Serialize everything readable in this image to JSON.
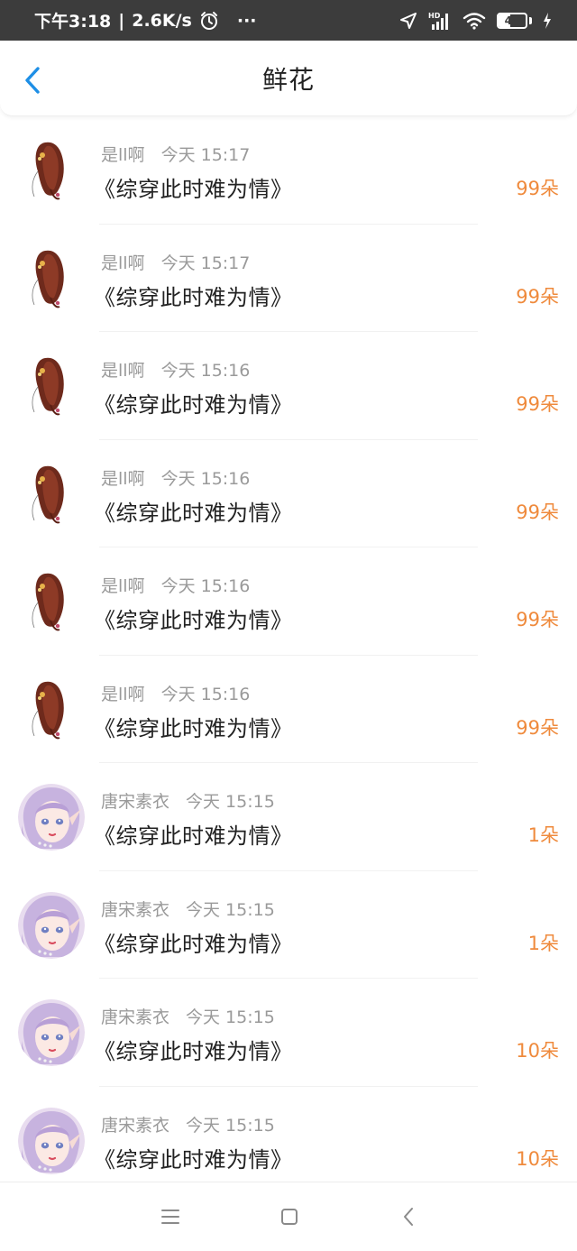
{
  "status_bar": {
    "time": "下午3:18",
    "separator": "|",
    "speed": "2.6K/s",
    "more": "···",
    "battery": "44",
    "battery_level": 0.44,
    "icons": [
      "alarm-icon",
      "location-arrow-icon",
      "hd-signal-icon",
      "wifi-icon",
      "battery-icon",
      "charging-icon"
    ]
  },
  "header": {
    "title": "鲜花",
    "back_icon": "chevron-left-icon",
    "accent_color": "#1e8fe6"
  },
  "gifts": [
    {
      "user": "是ll啊",
      "time": "今天 15:17",
      "book": "《综穿此时难为情》",
      "amount": "99朵",
      "avatar": "hair-avatar"
    },
    {
      "user": "是ll啊",
      "time": "今天 15:17",
      "book": "《综穿此时难为情》",
      "amount": "99朵",
      "avatar": "hair-avatar"
    },
    {
      "user": "是ll啊",
      "time": "今天 15:16",
      "book": "《综穿此时难为情》",
      "amount": "99朵",
      "avatar": "hair-avatar"
    },
    {
      "user": "是ll啊",
      "time": "今天 15:16",
      "book": "《综穿此时难为情》",
      "amount": "99朵",
      "avatar": "hair-avatar"
    },
    {
      "user": "是ll啊",
      "time": "今天 15:16",
      "book": "《综穿此时难为情》",
      "amount": "99朵",
      "avatar": "hair-avatar"
    },
    {
      "user": "是ll啊",
      "time": "今天 15:16",
      "book": "《综穿此时难为情》",
      "amount": "99朵",
      "avatar": "hair-avatar"
    },
    {
      "user": "唐宋素衣",
      "time": "今天 15:15",
      "book": "《综穿此时难为情》",
      "amount": "1朵",
      "avatar": "elf-girl-avatar"
    },
    {
      "user": "唐宋素衣",
      "time": "今天 15:15",
      "book": "《综穿此时难为情》",
      "amount": "1朵",
      "avatar": "elf-girl-avatar"
    },
    {
      "user": "唐宋素衣",
      "time": "今天 15:15",
      "book": "《综穿此时难为情》",
      "amount": "10朵",
      "avatar": "elf-girl-avatar"
    },
    {
      "user": "唐宋素衣",
      "time": "今天 15:15",
      "book": "《综穿此时难为情》",
      "amount": "10朵",
      "avatar": "elf-girl-avatar"
    }
  ],
  "colors": {
    "amount": "#ef8a3c",
    "meta_text": "#9a9a9a",
    "status_bar_bg": "#3c3c3c"
  },
  "nav_bar": {
    "buttons": [
      "menu-icon",
      "home-square-icon",
      "back-triangle-icon"
    ]
  }
}
